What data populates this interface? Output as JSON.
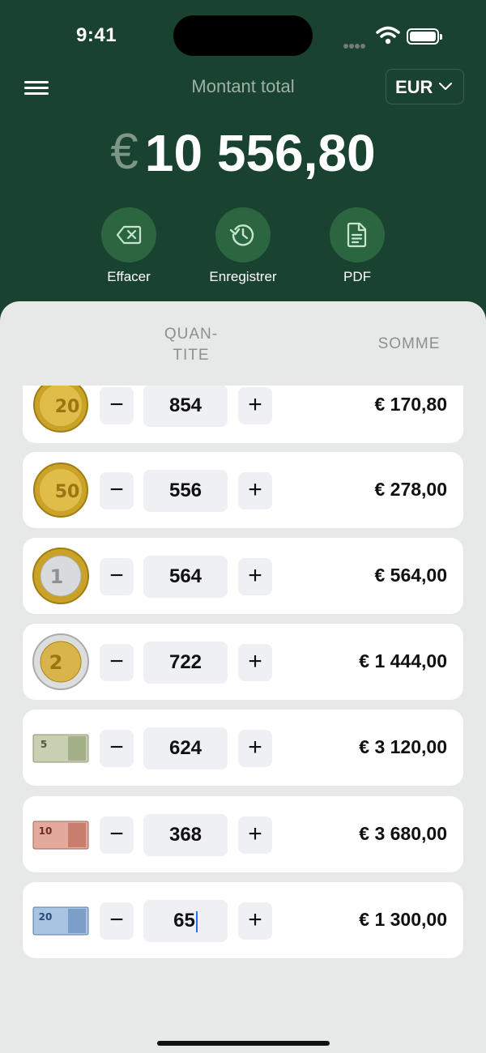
{
  "status_bar": {
    "time": "9:41"
  },
  "header": {
    "title": "Montant total",
    "currency": "EUR"
  },
  "total": {
    "symbol": "€",
    "value": "10 556,80"
  },
  "actions": [
    {
      "label": "Effacer",
      "icon": "erase-icon"
    },
    {
      "label": "Enregistrer",
      "icon": "history-icon"
    },
    {
      "label": "PDF",
      "icon": "document-icon"
    }
  ],
  "table": {
    "qty_header": "QUAN-\nTITE",
    "sum_header": "SOMME",
    "rows": [
      {
        "denomination": "20 cent coin",
        "mark": "20",
        "quantity": "854",
        "sum": "€ 170,80"
      },
      {
        "denomination": "50 cent coin",
        "mark": "50",
        "quantity": "556",
        "sum": "€ 278,00"
      },
      {
        "denomination": "1 euro coin",
        "mark": "1",
        "quantity": "564",
        "sum": "€ 564,00"
      },
      {
        "denomination": "2 euro coin",
        "mark": "2",
        "quantity": "722",
        "sum": "€ 1 444,00"
      },
      {
        "denomination": "5 euro banknote",
        "mark": "5",
        "quantity": "624",
        "sum": "€ 3 120,00"
      },
      {
        "denomination": "10 euro banknote",
        "mark": "10",
        "quantity": "368",
        "sum": "€ 3 680,00"
      },
      {
        "denomination": "20 euro banknote",
        "mark": "20",
        "quantity": "65",
        "sum": "€ 1 300,00"
      }
    ],
    "minus_label": "−",
    "plus_label": "+"
  },
  "colors": {
    "header_bg": "#1a4230",
    "action_bg": "#2c6640",
    "sheet_bg": "#e6e9e8",
    "cursor": "#2a6cf0"
  }
}
